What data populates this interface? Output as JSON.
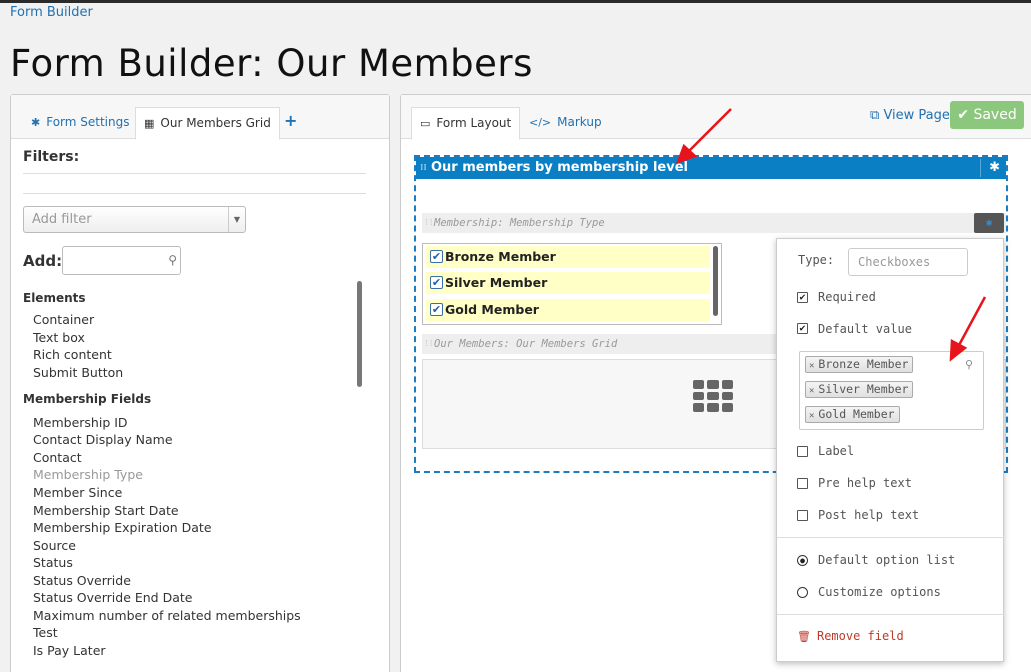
{
  "breadcrumb": "Form Builder",
  "page_title": "Form Builder: Our Members",
  "left": {
    "tabs": [
      {
        "label": "Form Settings",
        "icon": "gear-icon"
      },
      {
        "label": "Our Members Grid",
        "icon": "grid-icon"
      }
    ],
    "add_tab_glyph": "+",
    "filters_title": "Filters:",
    "filter_placeholder": "Add filter",
    "add_label": "Add:",
    "elements_title": "Elements",
    "elements": [
      "Container",
      "Text box",
      "Rich content",
      "Submit Button"
    ],
    "membership_title": "Membership Fields",
    "membership_fields": [
      "Membership ID",
      "Contact Display Name",
      "Contact",
      "Membership Type",
      "Member Since",
      "Membership Start Date",
      "Membership Expiration Date",
      "Source",
      "Status",
      "Status Override",
      "Status Override End Date",
      "Maximum number of related memberships",
      "Test",
      "Is Pay Later"
    ],
    "disabled_field": "Membership Type"
  },
  "right": {
    "tabs": [
      {
        "label": "Form Layout",
        "icon": "form-icon"
      },
      {
        "label": "Markup",
        "icon": "code-icon"
      }
    ],
    "view_page": "View Page",
    "saved": "Saved",
    "container_title": "Our members by membership level",
    "field1_label": "Membership: Membership Type",
    "checkbox_options": [
      "Bronze Member",
      "Silver Member",
      "Gold Member"
    ],
    "field2_label": "Our Members: Our Members Grid"
  },
  "popup": {
    "type_label": "Type:",
    "type_value": "Checkboxes",
    "required_label": "Required",
    "default_value_label": "Default value",
    "default_chips": [
      "Bronze Member",
      "Silver Member",
      "Gold Member"
    ],
    "label_label": "Label",
    "pre_help_label": "Pre help text",
    "post_help_label": "Post help text",
    "default_option_list": "Default option list",
    "customize_options": "Customize options",
    "remove_field": "Remove field"
  },
  "colors": {
    "link": "#2271b1",
    "saved_green": "#8cc77e",
    "container_blue": "#0a7fc4",
    "highlight_yellow": "#ffffc6",
    "remove_red": "#c0392b",
    "annotation_arrow": "#e8141c"
  }
}
